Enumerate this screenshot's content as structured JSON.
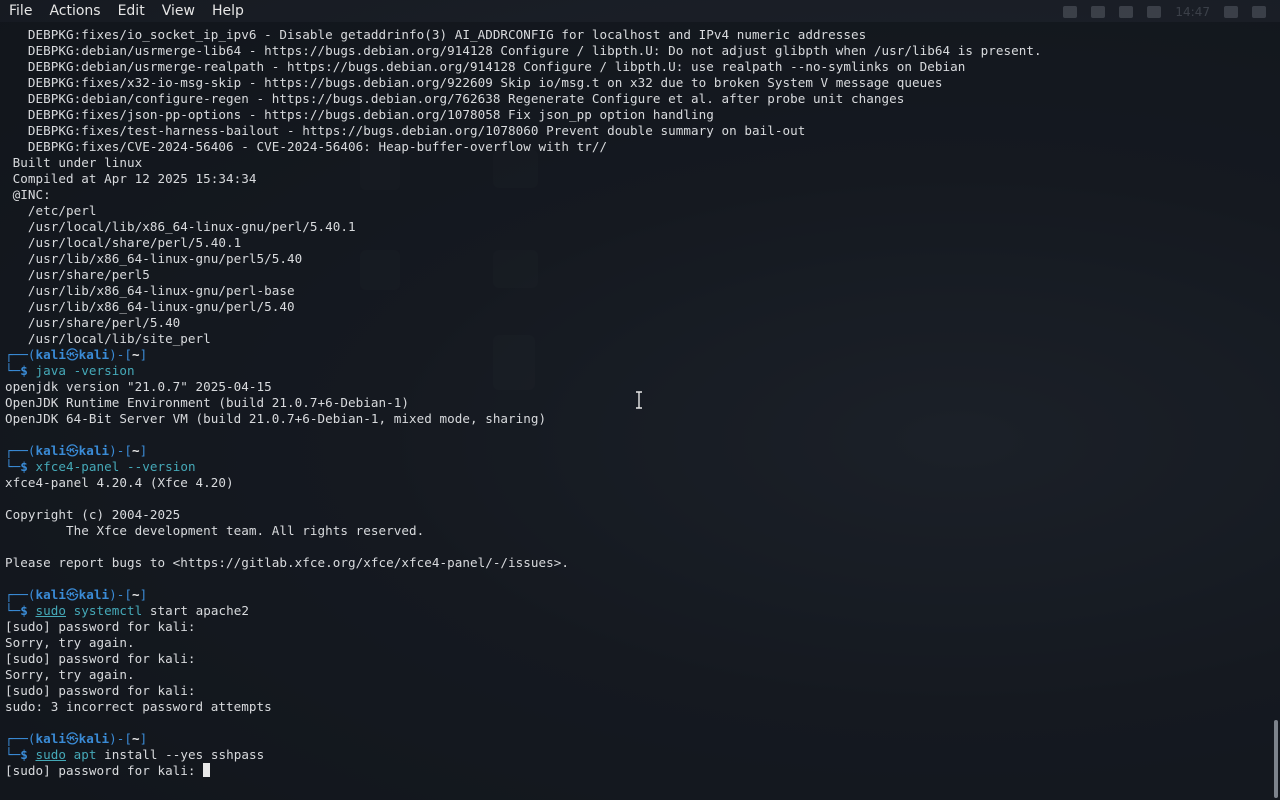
{
  "menubar": {
    "items": [
      "File",
      "Actions",
      "Edit",
      "View",
      "Help"
    ]
  },
  "panel": {
    "clock": "14:47"
  },
  "prompt": {
    "user": "kali",
    "host": "kali",
    "path": "~",
    "skull": "㉿"
  },
  "output_top": [
    "   DEBPKG:fixes/io_socket_ip_ipv6 - Disable getaddrinfo(3) AI_ADDRCONFIG for localhost and IPv4 numeric addresses",
    "   DEBPKG:debian/usrmerge-lib64 - https://bugs.debian.org/914128 Configure / libpth.U: Do not adjust glibpth when /usr/lib64 is present.",
    "   DEBPKG:debian/usrmerge-realpath - https://bugs.debian.org/914128 Configure / libpth.U: use realpath --no-symlinks on Debian",
    "   DEBPKG:fixes/x32-io-msg-skip - https://bugs.debian.org/922609 Skip io/msg.t on x32 due to broken System V message queues",
    "   DEBPKG:debian/configure-regen - https://bugs.debian.org/762638 Regenerate Configure et al. after probe unit changes",
    "   DEBPKG:fixes/json-pp-options - https://bugs.debian.org/1078058 Fix json_pp option handling",
    "   DEBPKG:fixes/test-harness-bailout - https://bugs.debian.org/1078060 Prevent double summary on bail-out",
    "   DEBPKG:fixes/CVE-2024-56406 - CVE-2024-56406: Heap-buffer-overflow with tr//",
    " Built under linux",
    " Compiled at Apr 12 2025 15:34:34",
    " @INC:",
    "   /etc/perl",
    "   /usr/local/lib/x86_64-linux-gnu/perl/5.40.1",
    "   /usr/local/share/perl/5.40.1",
    "   /usr/lib/x86_64-linux-gnu/perl5/5.40",
    "   /usr/share/perl5",
    "   /usr/lib/x86_64-linux-gnu/perl-base",
    "   /usr/lib/x86_64-linux-gnu/perl/5.40",
    "   /usr/share/perl/5.40",
    "   /usr/local/lib/site_perl"
  ],
  "session": [
    {
      "cmd": "java",
      "cmd_underline": false,
      "args": " -version",
      "output": [
        "openjdk version \"21.0.7\" 2025-04-15",
        "OpenJDK Runtime Environment (build 21.0.7+6-Debian-1)",
        "OpenJDK 64-Bit Server VM (build 21.0.7+6-Debian-1, mixed mode, sharing)",
        ""
      ]
    },
    {
      "cmd": "xfce4-panel",
      "cmd_underline": false,
      "args": " --version",
      "output": [
        "xfce4-panel 4.20.4 (Xfce 4.20)",
        "",
        "Copyright (c) 2004-2025",
        "        The Xfce development team. All rights reserved.",
        "",
        "Please report bugs to <https://gitlab.xfce.org/xfce/xfce4-panel/-/issues>.",
        ""
      ]
    },
    {
      "cmd": "sudo",
      "cmd_underline": true,
      "cmd2": "systemctl",
      "args": " start apache2",
      "output": [
        "[sudo] password for kali:",
        "Sorry, try again.",
        "[sudo] password for kali:",
        "Sorry, try again.",
        "[sudo] password for kali:",
        "sudo: 3 incorrect password attempts",
        ""
      ]
    },
    {
      "cmd": "sudo",
      "cmd_underline": true,
      "cmd2": "apt",
      "args": " install --yes sshpass",
      "output": []
    }
  ],
  "current_input_line": "[sudo] password for kali: "
}
